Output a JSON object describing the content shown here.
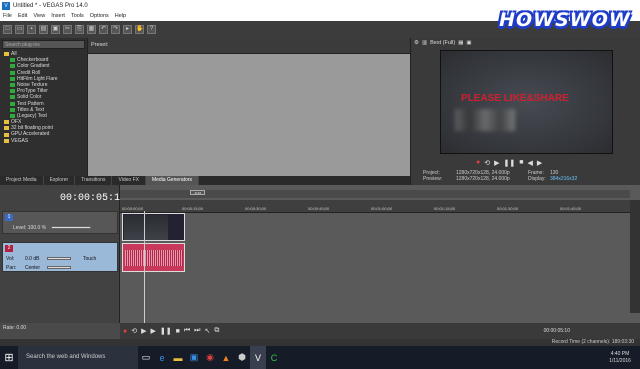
{
  "window": {
    "title": "Untitled * - VEGAS Pro 14.0"
  },
  "menu": [
    "File",
    "Edit",
    "View",
    "Insert",
    "Tools",
    "Options",
    "Help"
  ],
  "logo": "HOWSWOW",
  "plugins": {
    "search_placeholder": "Search plug-ins",
    "tree": [
      {
        "label": "All",
        "kind": "folder"
      },
      {
        "label": "Checkerboard",
        "kind": "plugin"
      },
      {
        "label": "Color Gradient",
        "kind": "plugin"
      },
      {
        "label": "Credit Roll",
        "kind": "plugin"
      },
      {
        "label": "HitFilm Light Flare",
        "kind": "plugin"
      },
      {
        "label": "Noise Texture",
        "kind": "plugin"
      },
      {
        "label": "ProType Titler",
        "kind": "plugin"
      },
      {
        "label": "Solid Color",
        "kind": "plugin"
      },
      {
        "label": "Test Pattern",
        "kind": "plugin"
      },
      {
        "label": "Titles & Text",
        "kind": "plugin"
      },
      {
        "label": "(Legacy) Text",
        "kind": "plugin"
      },
      {
        "label": "OFX",
        "kind": "folder"
      },
      {
        "label": "32 bit floating point",
        "kind": "folder"
      },
      {
        "label": "GPU Accelerated",
        "kind": "folder"
      },
      {
        "label": "VEGAS",
        "kind": "folder"
      }
    ]
  },
  "preset": {
    "label": "Preset:"
  },
  "tabs": [
    "Project Media",
    "Explorer",
    "Transitions",
    "Video FX",
    "Media Generators"
  ],
  "preview": {
    "quality": "Best (Full)",
    "video_text": "PLEASE LIKE&SHARE",
    "project_label": "Project:",
    "project_value": "1280x720x128, 24.000p",
    "preview_label": "Preview:",
    "preview_value": "1280x720x128, 24.000p",
    "frame_label": "Frame:",
    "frame_value": "130",
    "display_label": "Display:",
    "display_value": "384x216x32"
  },
  "timeline": {
    "timecode": "00:00:05:10",
    "marker": "-5:13",
    "ruler": [
      "00:00:00;00",
      "00:00:15;00",
      "00:00:30;00",
      "00:00:45;00",
      "00:01:00;00",
      "00:01:15;00",
      "00:01:30;00",
      "00:01:45;00"
    ],
    "track1": {
      "num": "1",
      "level": "Level: 100.0 %"
    },
    "track2": {
      "num": "2",
      "vol_label": "Vol:",
      "vol": "0.0 dB",
      "touch": "Touch",
      "pan_label": "Pan:",
      "pan": "Center"
    },
    "rate": "Rate: 0.00",
    "transport_tc": "00:00:05:10"
  },
  "status": {
    "record_time": "Record Time (2 channels): 189:03:30"
  },
  "taskbar": {
    "search": "Search the web and Windows",
    "time": "4:40 PM",
    "date": "1/11/2016"
  }
}
